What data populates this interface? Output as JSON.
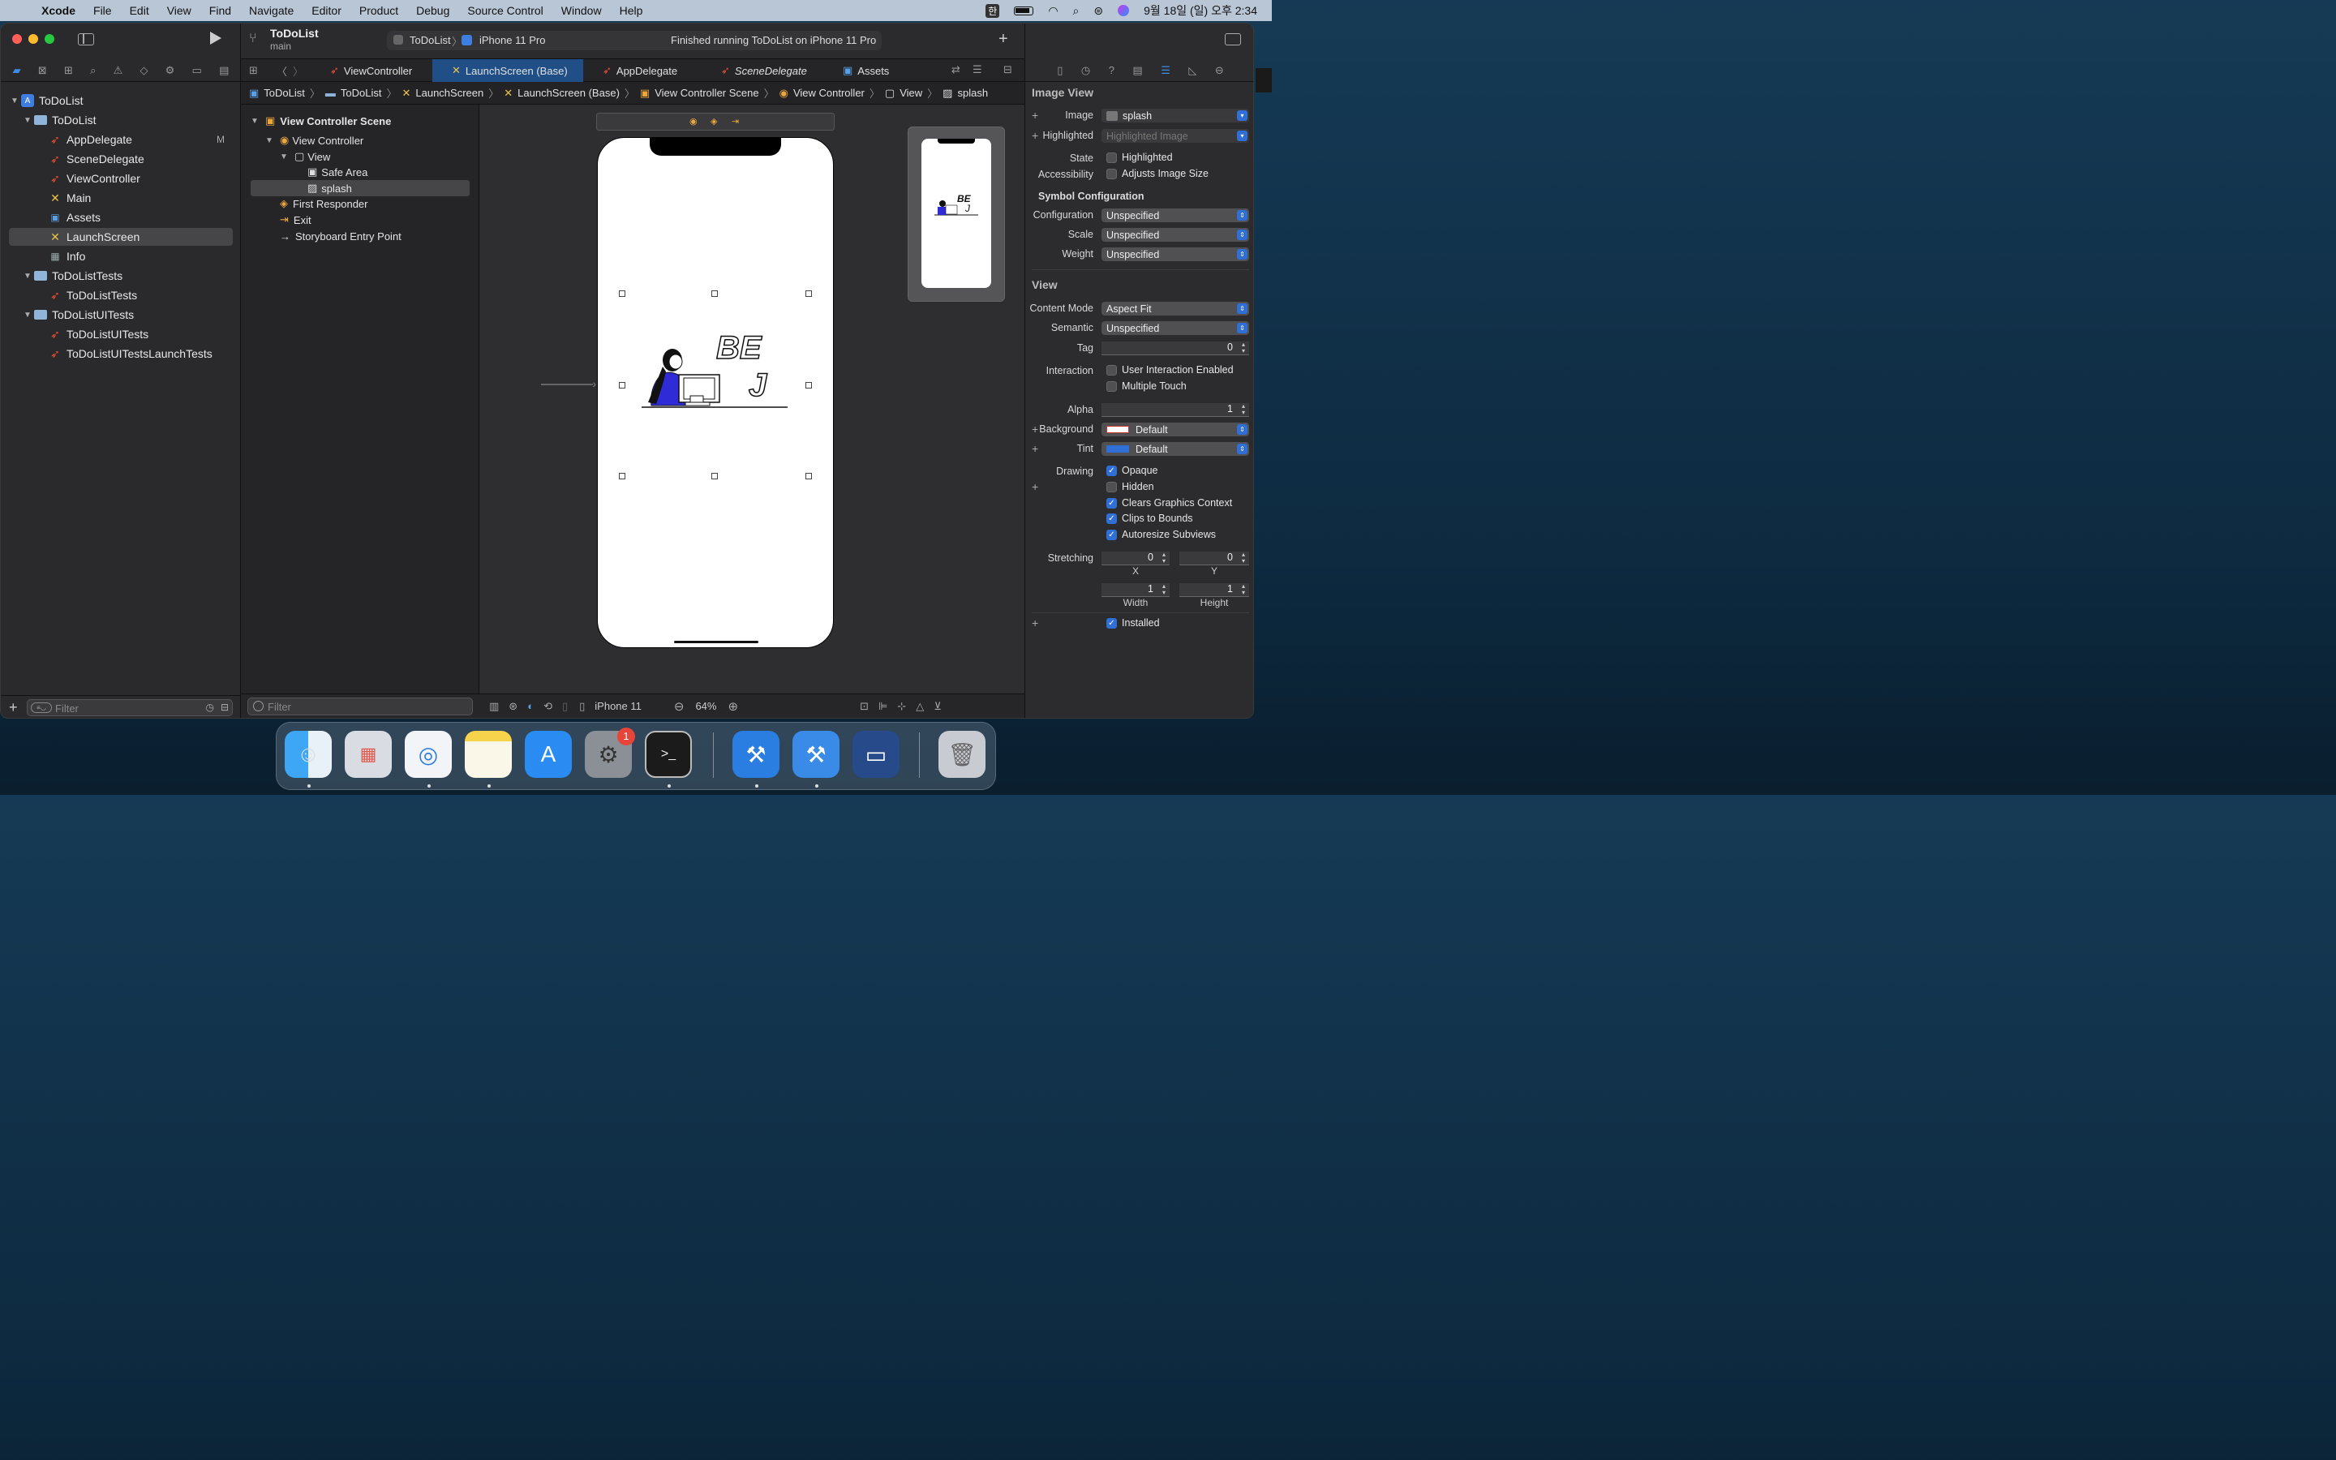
{
  "menubar": {
    "app": "Xcode",
    "items": [
      "File",
      "Edit",
      "View",
      "Find",
      "Navigate",
      "Editor",
      "Product",
      "Debug",
      "Source Control",
      "Window",
      "Help"
    ],
    "input_indicator": "한",
    "clock": "9월 18일 (일) 오후 2:34"
  },
  "window": {
    "scheme_title": "ToDoList",
    "scheme_branch": "main",
    "target_app": "ToDoList",
    "target_device": "iPhone 11 Pro",
    "status": "Finished running ToDoList on iPhone 11 Pro"
  },
  "navigator": {
    "items": [
      {
        "label": "ToDoList",
        "icon": "project-icon"
      },
      {
        "label": "ToDoList",
        "icon": "folder-icon"
      },
      {
        "label": "AppDelegate",
        "icon": "swift-file-icon",
        "badge": "M"
      },
      {
        "label": "SceneDelegate",
        "icon": "swift-file-icon"
      },
      {
        "label": "ViewController",
        "icon": "swift-file-icon"
      },
      {
        "label": "Main",
        "icon": "storyboard-icon"
      },
      {
        "label": "Assets",
        "icon": "assets-icon"
      },
      {
        "label": "LaunchScreen",
        "icon": "storyboard-icon"
      },
      {
        "label": "Info",
        "icon": "plist-icon"
      },
      {
        "label": "ToDoListTests",
        "icon": "folder-icon"
      },
      {
        "label": "ToDoListTests",
        "icon": "swift-file-icon"
      },
      {
        "label": "ToDoListUITests",
        "icon": "folder-icon"
      },
      {
        "label": "ToDoListUITests",
        "icon": "swift-file-icon"
      },
      {
        "label": "ToDoListUITestsLaunchTests",
        "icon": "swift-file-icon"
      }
    ],
    "filter_placeholder": "Filter"
  },
  "tabs": [
    "ViewController",
    "LaunchScreen (Base)",
    "AppDelegate",
    "SceneDelegate",
    "Assets"
  ],
  "jumpbar": [
    "ToDoList",
    "ToDoList",
    "LaunchScreen",
    "LaunchScreen (Base)",
    "View Controller Scene",
    "View Controller",
    "View",
    "splash"
  ],
  "outline": {
    "items": [
      "View Controller Scene",
      "View Controller",
      "View",
      "Safe Area",
      "splash",
      "First Responder",
      "Exit",
      "Storyboard Entry Point"
    ],
    "filter_placeholder": "Filter"
  },
  "canvas": {
    "device": "iPhone 11",
    "zoom": "64%",
    "splash_text": "BE J"
  },
  "inspector": {
    "image_view_title": "Image View",
    "image_label": "Image",
    "image_value": "splash",
    "highlighted_label": "Highlighted",
    "highlighted_placeholder": "Highlighted Image",
    "state_label": "State",
    "state_option": "Highlighted",
    "accessibility_label": "Accessibility",
    "accessibility_option": "Adjusts Image Size",
    "symbol_config_title": "Symbol Configuration",
    "configuration_label": "Configuration",
    "configuration_value": "Unspecified",
    "scale_label": "Scale",
    "scale_value": "Unspecified",
    "weight_label": "Weight",
    "weight_value": "Unspecified",
    "view_title": "View",
    "content_mode_label": "Content Mode",
    "content_mode_value": "Aspect Fit",
    "semantic_label": "Semantic",
    "semantic_value": "Unspecified",
    "tag_label": "Tag",
    "tag_value": "0",
    "interaction_label": "Interaction",
    "user_interaction": "User Interaction Enabled",
    "multiple_touch": "Multiple Touch",
    "alpha_label": "Alpha",
    "alpha_value": "1",
    "background_label": "Background",
    "background_value": "Default",
    "tint_label": "Tint",
    "tint_value": "Default",
    "drawing_label": "Drawing",
    "opaque": "Opaque",
    "hidden": "Hidden",
    "clears_graphics": "Clears Graphics Context",
    "clips_bounds": "Clips to Bounds",
    "autoresize": "Autoresize Subviews",
    "stretching_label": "Stretching",
    "stretch_x": "0",
    "stretch_y": "0",
    "stretch_w": "1",
    "stretch_h": "1",
    "x_label": "X",
    "y_label": "Y",
    "width_label": "Width",
    "height_label": "Height",
    "installed": "Installed"
  },
  "dock": {
    "apps": [
      "Finder",
      "Launchpad",
      "Safari",
      "Notes",
      "App Store",
      "System Preferences",
      "Terminal",
      "Xcode",
      "Xcode Beta",
      "Screen Sharing",
      "Trash"
    ],
    "notification_badge": "1"
  }
}
